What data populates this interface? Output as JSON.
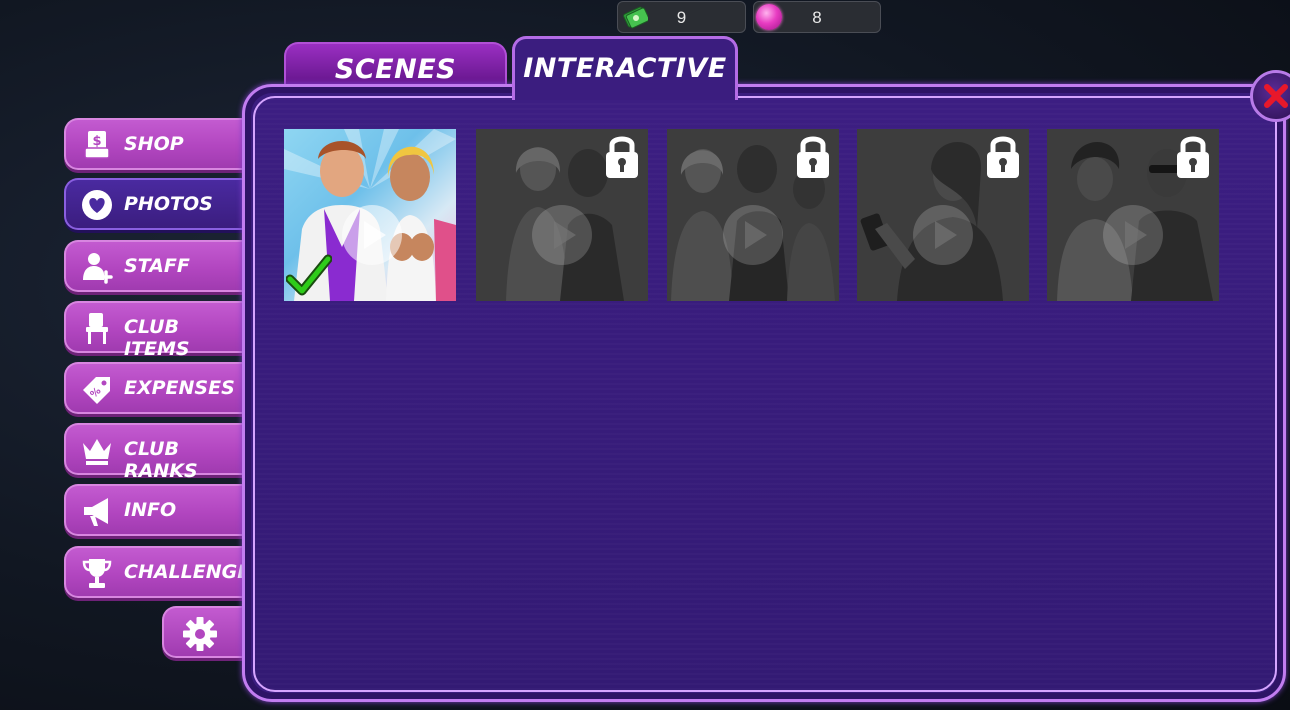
{
  "currency": {
    "cash": {
      "icon": "cash-icon",
      "value": "9"
    },
    "gems": {
      "icon": "gem-icon",
      "value": "8"
    }
  },
  "tabs": [
    {
      "label": "SCENES",
      "active": false
    },
    {
      "label": "INTERACTIVE",
      "active": true
    }
  ],
  "sidebar": {
    "items": [
      {
        "label": "SHOP",
        "icon": "shop-receipt-icon",
        "active": false
      },
      {
        "label": "PHOTOS",
        "icon": "heart-icon",
        "active": true
      },
      {
        "label": "STAFF",
        "icon": "add-person-icon",
        "active": false
      },
      {
        "label": "CLUB ITEMS",
        "icon": "chair-icon",
        "active": false
      },
      {
        "label": "EXPENSES",
        "icon": "price-tag-icon",
        "active": false
      },
      {
        "label": "CLUB RANKS",
        "icon": "crown-icon",
        "active": false
      },
      {
        "label": "INFO",
        "icon": "megaphone-icon",
        "active": false
      },
      {
        "label": "CHALLENGES",
        "icon": "trophy-icon",
        "active": false
      }
    ],
    "settings_icon": "gear-icon"
  },
  "videos": [
    {
      "state": "unlocked",
      "completed": true
    },
    {
      "state": "locked"
    },
    {
      "state": "locked"
    },
    {
      "state": "locked"
    },
    {
      "state": "locked"
    }
  ],
  "colors": {
    "panel": "#3b1d7f",
    "sidebar_button": "#b246c0",
    "accent_border": "#c27df0",
    "close": "#e8182a",
    "check": "#2ecc1a"
  }
}
